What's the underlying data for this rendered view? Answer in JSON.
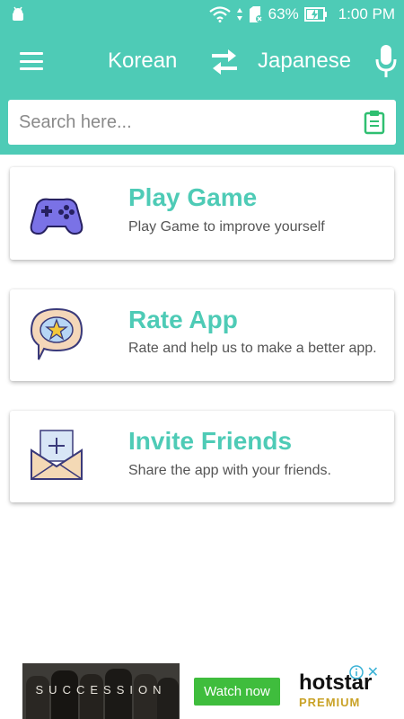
{
  "status_bar": {
    "battery": "63%",
    "time": "1:00 PM"
  },
  "toolbar": {
    "source_language": "Korean",
    "target_language": "Japanese"
  },
  "search": {
    "placeholder": "Search here..."
  },
  "cards": [
    {
      "title": "Play Game",
      "subtitle": "Play Game to improve yourself",
      "icon": "gamepad-icon"
    },
    {
      "title": "Rate App",
      "subtitle": "Rate and help us to make a better app.",
      "icon": "rate-star-icon"
    },
    {
      "title": "Invite Friends",
      "subtitle": "Share the app with your friends.",
      "icon": "invite-mail-icon"
    }
  ],
  "ad": {
    "image_text": "SUCCESSION",
    "button_label": "Watch now",
    "brand_name": "hotstar",
    "brand_sub": "PREMIUM"
  },
  "colors": {
    "primary": "#4ecbb6",
    "ad_button": "#3fbd3d"
  }
}
